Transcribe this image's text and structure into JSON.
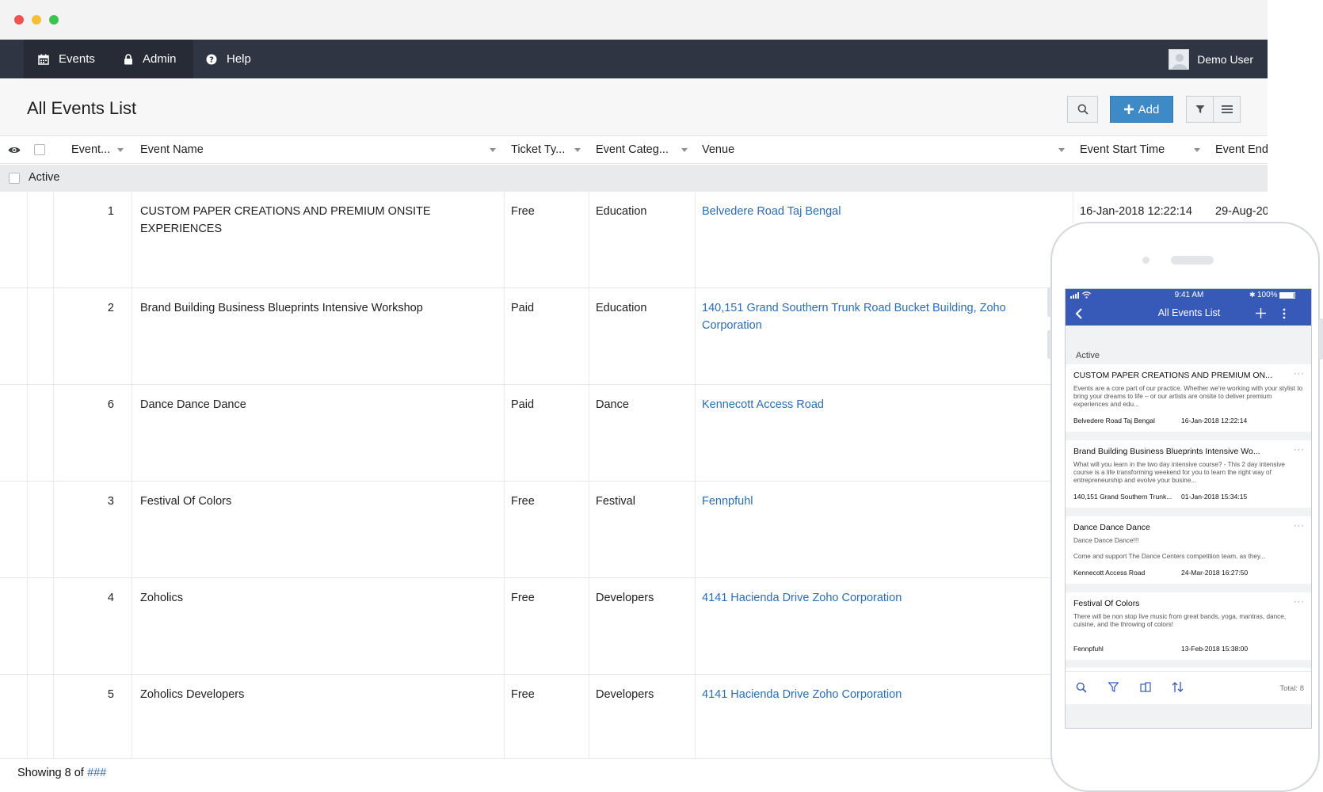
{
  "navbar": {
    "items": [
      {
        "label": "Events",
        "icon": "calendar-icon"
      },
      {
        "label": "Admin",
        "icon": "lock-icon"
      },
      {
        "label": "Help",
        "icon": "help-circle-icon"
      }
    ],
    "user_name": "Demo User"
  },
  "page": {
    "title": "All Events List",
    "add_label": "Add"
  },
  "table": {
    "columns": [
      "Event...",
      "Event Name",
      "Ticket Ty...",
      "Event Categ...",
      "Venue",
      "Event Start Time",
      "Event End"
    ],
    "group_label": "Active",
    "rows": [
      {
        "id": "1",
        "name": "CUSTOM PAPER CREATIONS AND PREMIUM ONSITE EXPERIENCES",
        "ticket": "Free",
        "category": "Education",
        "venue": "Belvedere Road Taj Bengal",
        "start": "16-Jan-2018 12:22:14",
        "end": "29-Aug-20"
      },
      {
        "id": "2",
        "name": "Brand Building Business Blueprints Intensive Workshop",
        "ticket": "Paid",
        "category": "Education",
        "venue": "140,151 Grand Southern Trunk Road Bucket Building, Zoho Corporation",
        "start": "",
        "end": ""
      },
      {
        "id": "6",
        "name": "Dance Dance Dance",
        "ticket": "Paid",
        "category": "Dance",
        "venue": "Kennecott Access Road",
        "start": "",
        "end": ""
      },
      {
        "id": "3",
        "name": "Festival Of Colors",
        "ticket": "Free",
        "category": "Festival",
        "venue": "Fennpfuhl",
        "start": "",
        "end": ""
      },
      {
        "id": "4",
        "name": "Zoholics",
        "ticket": "Free",
        "category": "Developers",
        "venue": "4141 Hacienda Drive Zoho Corporation",
        "start": "",
        "end": ""
      },
      {
        "id": "5",
        "name": "Zoholics Developers",
        "ticket": "Free",
        "category": "Developers",
        "venue": "4141 Hacienda Drive Zoho Corporation",
        "start": "",
        "end": ""
      }
    ]
  },
  "footer": {
    "prefix": "Showing 8 of ",
    "count": "###"
  },
  "mobile": {
    "status": {
      "time": "9:41 AM",
      "battery": "100%"
    },
    "title": "All Events List",
    "group_label": "Active",
    "cards": [
      {
        "title": "CUSTOM PAPER CREATIONS AND PREMIUM ON...",
        "desc": "Events are a core part of our practice.\nWhether we're working with your stylist to bring your dreams to life – or our artists are onsite to deliver premium experiences and edu...",
        "venue": "Belvedere Road Taj Bengal",
        "date": "16-Jan-2018 12:22:14"
      },
      {
        "title": "Brand Building Business Blueprints Intensive Wo...",
        "desc": "What will you learn in the two day intensive course?\n- This 2 day intensive course is a life transforming weekend for you to learn the right way of entrepreneurship and evolve your busine...",
        "venue": "140,151 Grand Southern Trunk...",
        "date": "01-Jan-2018 15:34:15"
      },
      {
        "title": "Dance Dance Dance",
        "desc": "Dance Dance Dance!!!\n\nCome and support The Dance Centers competition team, as they...",
        "venue": "Kennecott Access Road",
        "date": "24-Mar-2018 16:27:50"
      },
      {
        "title": "Festival Of Colors",
        "desc": "There will be non stop live music from great bands, yoga, mantras, dance, cuisine, and the throwing of colors!",
        "venue": "Fennpfuhl",
        "date": "13-Feb-2018 15:38:00"
      }
    ],
    "total": "Total: 8"
  },
  "colors": {
    "navbar": "#2f3542",
    "accent": "#3d8ac6",
    "link": "#2b6db3",
    "mobile_header": "#3759b8"
  }
}
